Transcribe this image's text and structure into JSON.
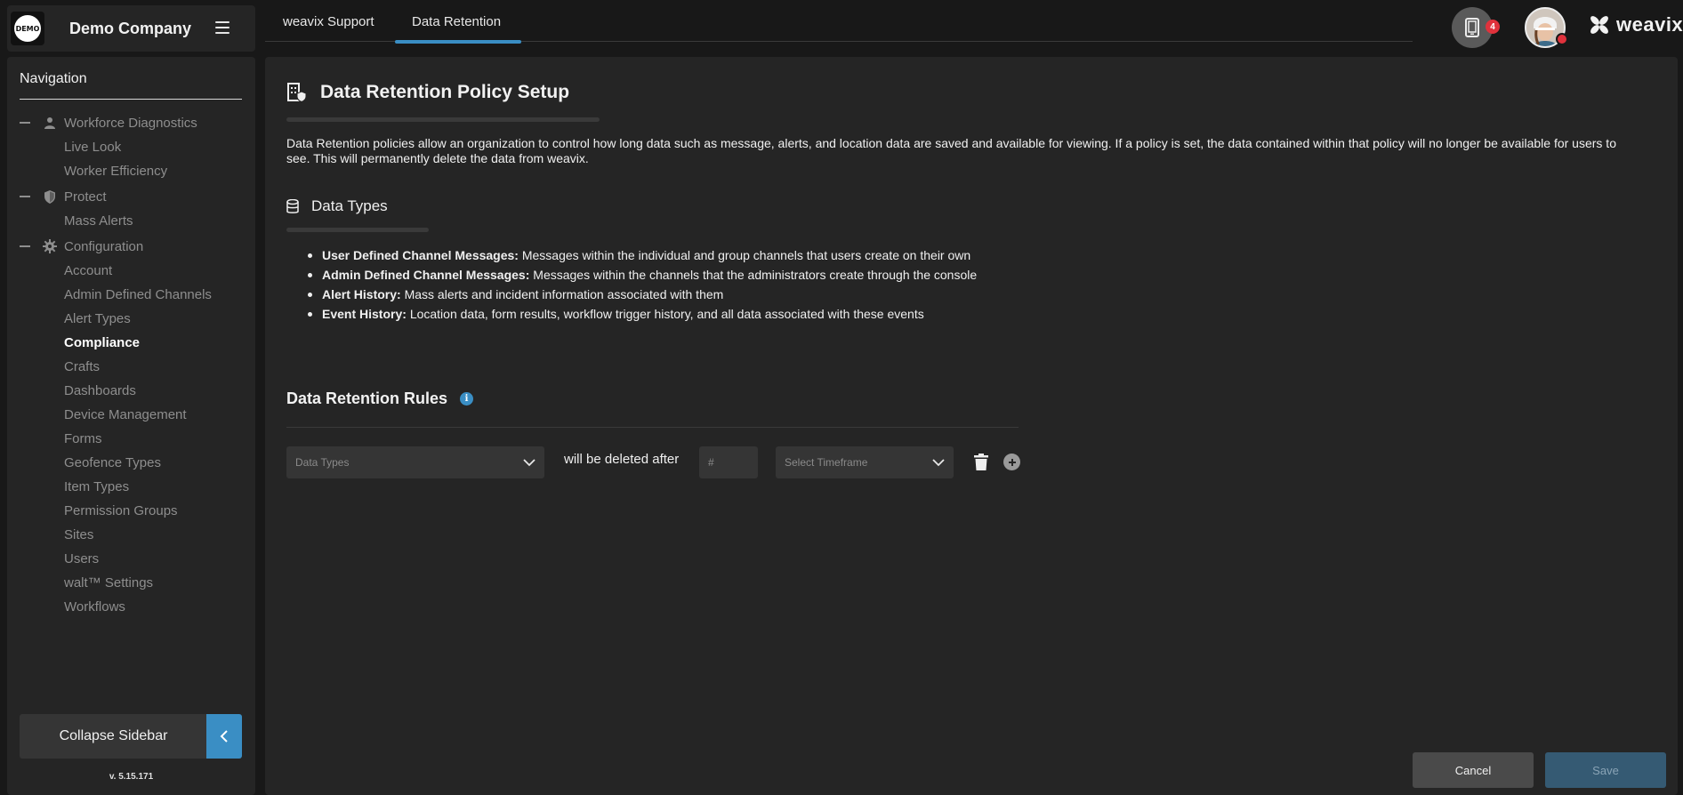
{
  "company": {
    "logo_text": "DEMO",
    "name": "Demo Company"
  },
  "sidebar": {
    "title": "Navigation",
    "groups": [
      {
        "label": "Workforce Diagnostics",
        "icon": "person-icon",
        "items": [
          "Live Look",
          "Worker Efficiency"
        ]
      },
      {
        "label": "Protect",
        "icon": "shield-icon",
        "items": [
          "Mass Alerts"
        ]
      },
      {
        "label": "Configuration",
        "icon": "gear-icon",
        "items": [
          "Account",
          "Admin Defined Channels",
          "Alert Types",
          "Compliance",
          "Crafts",
          "Dashboards",
          "Device Management",
          "Forms",
          "Geofence Types",
          "Item Types",
          "Permission Groups",
          "Sites",
          "Users",
          "walt™ Settings",
          "Workflows"
        ]
      }
    ],
    "active_item": "Compliance",
    "collapse_label": "Collapse Sidebar",
    "version": "v. 5.15.171"
  },
  "tabs": [
    {
      "label": "weavix Support",
      "active": false
    },
    {
      "label": "Data Retention",
      "active": true
    }
  ],
  "header": {
    "device_badge_count": "4",
    "brand_name": "weavix"
  },
  "main": {
    "title": "Data Retention Policy Setup",
    "description": "Data Retention policies allow an organization to control how long data such as message, alerts, and location data are saved and available for viewing. If a policy is set, the data contained within that policy will no longer be available for users to see. This will permanently delete the data from weavix.",
    "data_types_title": "Data Types",
    "data_types": [
      {
        "term": "User Defined Channel Messages:",
        "desc": "Messages within the individual and group channels that users create on their own"
      },
      {
        "term": "Admin Defined Channel Messages:",
        "desc": "Messages within the channels that the administrators create through the console"
      },
      {
        "term": "Alert History:",
        "desc": "Mass alerts and incident information associated with them"
      },
      {
        "term": "Event History:",
        "desc": "Location data, form results, workflow trigger history, and all data associated with these events"
      }
    ],
    "rules_title": "Data Retention Rules",
    "rule": {
      "data_types_placeholder": "Data Types",
      "middle_text": "will be deleted after",
      "number_placeholder": "#",
      "timeframe_placeholder": "Select Timeframe"
    },
    "cancel_label": "Cancel",
    "save_label": "Save"
  },
  "colors": {
    "accent": "#3a8ec4",
    "badge": "#e0323c",
    "background": "#181818",
    "panel": "#252525"
  }
}
